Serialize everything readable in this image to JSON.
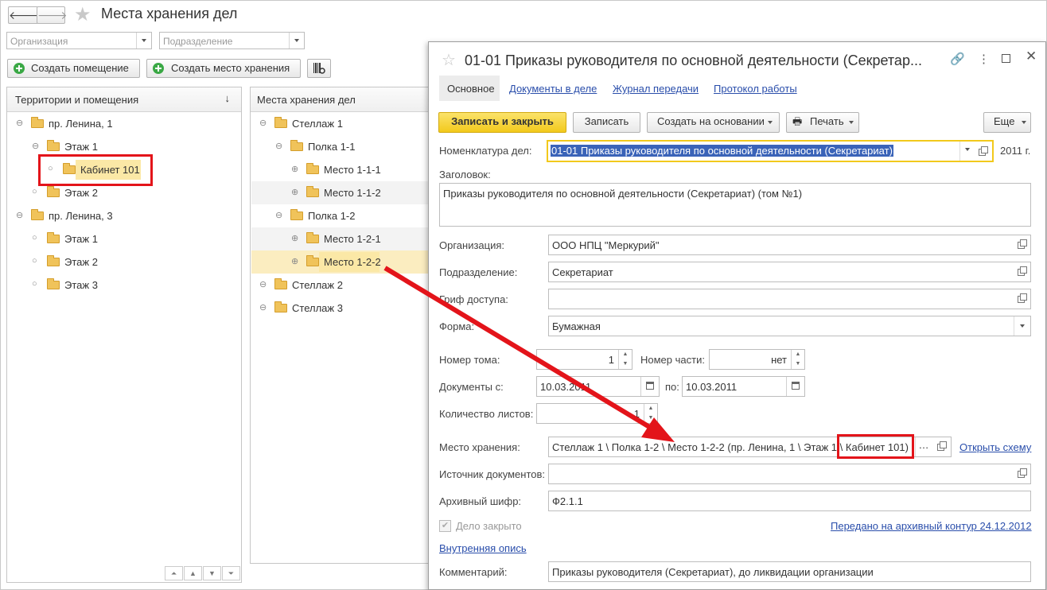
{
  "header": {
    "back_icon": "arrow-left-icon",
    "forward_icon": "arrow-right-icon",
    "favorite_icon": "star-icon",
    "title": "Места хранения дел"
  },
  "filters": {
    "organization_placeholder": "Организация",
    "department_placeholder": "Подразделение"
  },
  "toolbar": {
    "create_room": "Создать помещение",
    "create_storage": "Создать место хранения",
    "barcode_icon": "barcode-icon"
  },
  "territories": {
    "header": "Территории и помещения",
    "sort_icon": "↓",
    "rows": [
      {
        "label": "пр. Ленина, 1",
        "toggle": "⊖",
        "level": 0
      },
      {
        "label": "Этаж 1",
        "toggle": "⊖",
        "level": 1
      },
      {
        "label": "Кабинет 101",
        "toggle": "○",
        "level": 2
      },
      {
        "label": "Этаж 2",
        "toggle": "○",
        "level": 1
      },
      {
        "label": "пр. Ленина, 3",
        "toggle": "⊖",
        "level": 0
      },
      {
        "label": "Этаж 1",
        "toggle": "○",
        "level": 1
      },
      {
        "label": "Этаж 2",
        "toggle": "○",
        "level": 1
      },
      {
        "label": "Этаж 3",
        "toggle": "○",
        "level": 1
      }
    ]
  },
  "storage": {
    "header": "Места хранения дел",
    "rows": [
      {
        "label": "Стеллаж 1",
        "toggle": "⊖",
        "level": 0
      },
      {
        "label": "Полка 1-1",
        "toggle": "⊖",
        "level": 1
      },
      {
        "label": "Место 1-1-1",
        "toggle": "⊕",
        "level": 2
      },
      {
        "label": "Место 1-1-2",
        "toggle": "⊕",
        "level": 2
      },
      {
        "label": "Полка 1-2",
        "toggle": "⊖",
        "level": 1
      },
      {
        "label": "Место 1-2-1",
        "toggle": "⊕",
        "level": 2
      },
      {
        "label": "Место 1-2-2",
        "toggle": "⊕",
        "level": 2
      },
      {
        "label": "Стеллаж 2",
        "toggle": "⊖",
        "level": 0
      },
      {
        "label": "Стеллаж 3",
        "toggle": "⊖",
        "level": 0
      }
    ]
  },
  "dialog": {
    "title": "01-01 Приказы руководителя по основной деятельности (Секретар...",
    "tabs": [
      "Основное",
      "Документы в деле",
      "Журнал передачи",
      "Протокол работы"
    ],
    "buttons": {
      "save_close": "Записать и закрыть",
      "save": "Записать",
      "create_based": "Создать на основании",
      "print": "Печать",
      "more": "Еще"
    },
    "labels": {
      "nomenclature": "Номенклатура дел:",
      "heading": "Заголовок:",
      "organization": "Организация:",
      "department": "Подразделение:",
      "access": "Гриф доступа:",
      "form": "Форма:",
      "volume": "Номер тома:",
      "part": "Номер части:",
      "docs_from": "Документы с:",
      "docs_to": "по:",
      "sheets": "Количество листов:",
      "place": "Место хранения:",
      "source": "Источник документов:",
      "cipher": "Архивный шифр:",
      "closed": "Дело закрыто",
      "comment": "Комментарий:"
    },
    "values": {
      "nomenclature": "01-01 Приказы руководителя по основной деятельности (Секретариат)",
      "year": "2011 г.",
      "heading": "Приказы руководителя по основной деятельности (Секретариат) (том №1)",
      "organization": "ООО НПЦ \"Меркурий\"",
      "department": "Секретариат",
      "access": "",
      "form": "Бумажная",
      "volume": "1",
      "part": "нет",
      "docs_from": "10.03.2011",
      "docs_to": "10.03.2011",
      "sheets": "1",
      "place": "Стеллаж 1 \\ Полка 1-2 \\ Место 1-2-2 (пр. Ленина, 1 \\ Этаж 1 \\ Кабинет 101)",
      "source": "",
      "cipher": "Ф2.1.1",
      "comment": "Приказы руководителя (Секретариат), до ликвидации организации"
    },
    "links": {
      "open_scheme": "Открыть схему",
      "transferred": "Передано на архивный контур 24.12.2012",
      "inner_inventory": "Внутренняя опись"
    }
  },
  "colors": {
    "accent": "#f5d13b",
    "highlight_row": "#fbedc0",
    "annotation": "#e3141a",
    "link": "#2a4eab"
  }
}
